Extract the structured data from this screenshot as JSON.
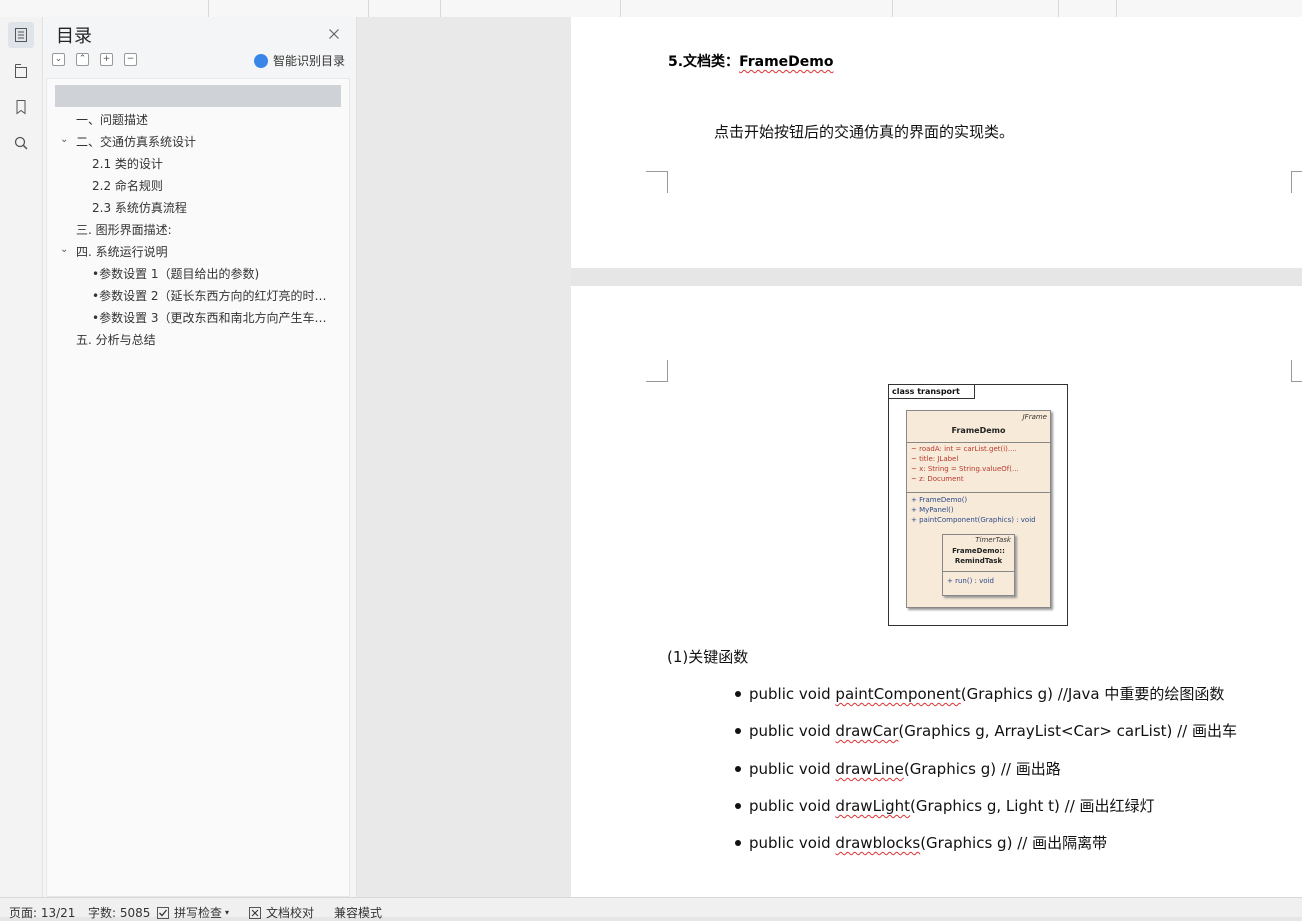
{
  "outline_panel": {
    "title": "目录",
    "smart_label": "智能识别目录",
    "items": [
      {
        "label": "一、问题描述",
        "level": 1
      },
      {
        "label": "二、交通仿真系统设计",
        "level": 1,
        "expanded": true
      },
      {
        "label": "2.1 类的设计",
        "level": 2
      },
      {
        "label": "2.2 命名规则",
        "level": 2
      },
      {
        "label": "2.3 系统仿真流程",
        "level": 2
      },
      {
        "label": "三. 图形界面描述:",
        "level": 1
      },
      {
        "label": "四. 系统运行说明",
        "level": 1,
        "expanded": true
      },
      {
        "label": "•参数设置 1（题目给出的参数)",
        "level": 2
      },
      {
        "label": "•参数设置 2（延长东西方向的红灯亮的时间...",
        "level": 2
      },
      {
        "label": "•参数设置 3（更改东西和南北方向产生车辆...",
        "level": 2
      },
      {
        "label": "五. 分析与总结",
        "level": 1
      }
    ]
  },
  "document": {
    "heading_prefix": "5.文档类：",
    "heading_class": "FrameDemo",
    "paragraph": "点击开始按钮后的交通仿真的界面的实现类。",
    "uml": {
      "frame_tag": "class transport",
      "stereotype": "JFrame",
      "class_name": "FrameDemo",
      "attributes": [
        "~  roadA:  int = carList.get(i)....",
        "~  title:  JLabel",
        "~  x:  String = String.valueOf(...",
        "~  z:  Document"
      ],
      "methods": [
        "+  FrameDemo()",
        "+  MyPanel()",
        "+  paintComponent(Graphics) : void"
      ],
      "inner_stereotype": "TimerTask",
      "inner_name_1": "FrameDemo::",
      "inner_name_2": "RemindTask",
      "inner_method": "+  run() : void"
    },
    "key_functions_title": "(1)关键函数",
    "functions": [
      {
        "pre": "public void ",
        "sq": "paintComponent",
        "post": "(Graphics g) //Java 中重要的绘图函数"
      },
      {
        "pre": "public void ",
        "sq": "drawCar",
        "post": "(Graphics g, ArrayList<Car> carList) // 画出车"
      },
      {
        "pre": "public void ",
        "sq": "drawLine",
        "post": "(Graphics g) // 画出路"
      },
      {
        "pre": "public void ",
        "sq": "drawLight",
        "post": "(Graphics g, Light t) // 画出红绿灯"
      },
      {
        "pre": "public void ",
        "sq": "drawblocks",
        "post": "(Graphics g) // 画出隔离带"
      }
    ]
  },
  "status_bar": {
    "page": "页面: 13/21",
    "words": "字数: 5085",
    "spellcheck": "拼写检查",
    "proofread": "文档校对",
    "compat": "兼容模式"
  },
  "colors": {
    "accent": "#3a86e8",
    "selection": "#cfd3d8",
    "spell_error": "#dd3333"
  }
}
